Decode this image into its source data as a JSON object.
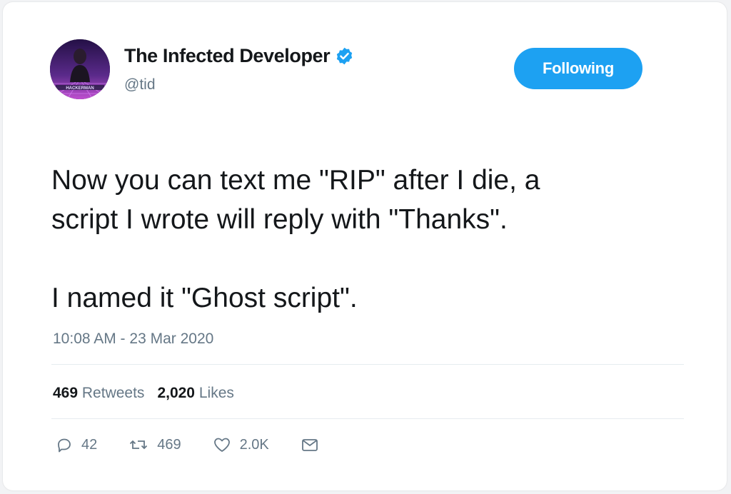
{
  "user": {
    "display_name": "The Infected Developer",
    "handle": "@tid",
    "avatar_caption": "HACKERMAN",
    "verified_icon": "verified-badge-icon"
  },
  "follow_button": {
    "label": "Following"
  },
  "tweet": {
    "text": "Now you can text me \"RIP\" after I die, a\nscript I wrote will reply with \"Thanks\".\n\nI named it \"Ghost script\".",
    "timestamp": "10:08 AM - 23 Mar 2020"
  },
  "stats": {
    "retweets_count": "469",
    "retweets_label": "Retweets",
    "likes_count": "2,020",
    "likes_label": "Likes"
  },
  "actions": {
    "reply_count": "42",
    "retweet_count": "469",
    "like_count": "2.0K",
    "icons": [
      "reply-icon",
      "retweet-icon",
      "like-icon",
      "direct-message-icon"
    ]
  },
  "colors": {
    "accent": "#1da1f2",
    "text": "#14171a",
    "secondary_text": "#657786",
    "divider": "#e6ecf0"
  }
}
